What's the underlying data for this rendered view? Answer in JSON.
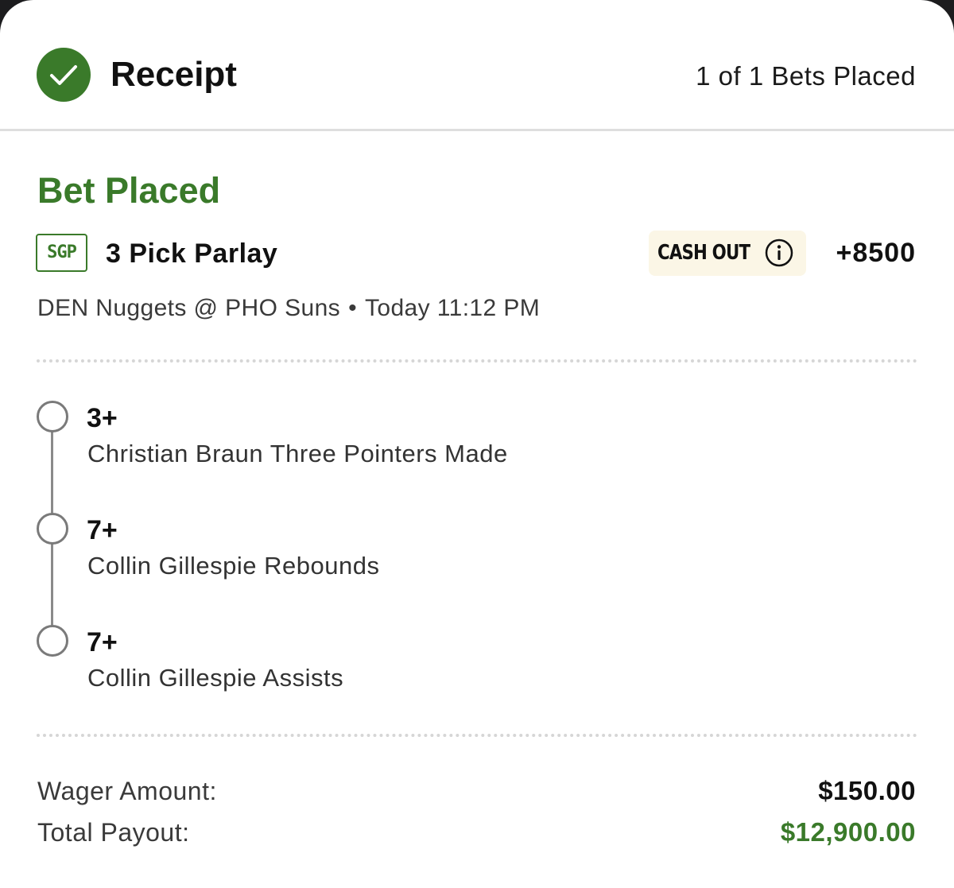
{
  "header": {
    "title": "Receipt",
    "bets_placed": "1 of 1 Bets Placed"
  },
  "bet": {
    "status": "Bet Placed",
    "badge": "SGP",
    "title": "3 Pick Parlay",
    "cash_out_label": "CASH OUT",
    "odds": "+8500",
    "matchup": "DEN Nuggets @ PHO Suns",
    "separator": "•",
    "time": "Today 11:12 PM"
  },
  "legs": [
    {
      "line": "3+",
      "description": "Christian Braun Three Pointers Made"
    },
    {
      "line": "7+",
      "description": "Collin Gillespie Rebounds"
    },
    {
      "line": "7+",
      "description": "Collin Gillespie Assists"
    }
  ],
  "summary": {
    "wager_label": "Wager Amount:",
    "wager_value": "$150.00",
    "payout_label": "Total Payout:",
    "payout_value": "$12,900.00"
  },
  "colors": {
    "accent_green": "#3a7a2a",
    "cash_out_bg": "#fbf6e6"
  },
  "icons": {
    "status": "check-circle-icon",
    "info": "info-icon"
  }
}
